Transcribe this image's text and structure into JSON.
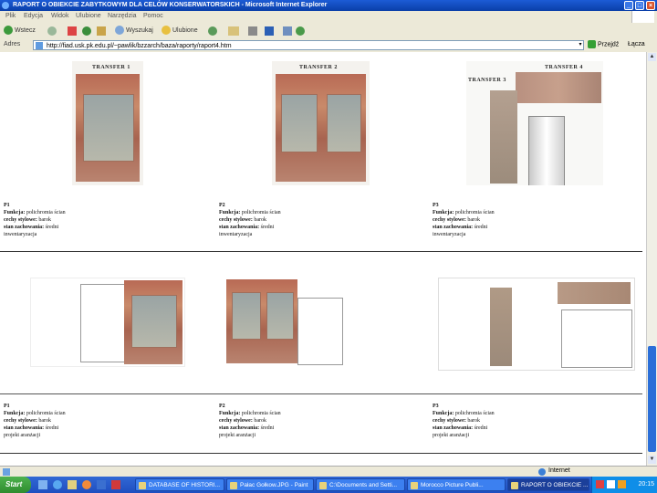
{
  "window": {
    "title": "RAPORT O OBIEKCIE ZABYTKOWYM DLA CELÓW KONSERWATORSKICH - Microsoft Internet Explorer"
  },
  "menubar": [
    "Plik",
    "Edycja",
    "Widok",
    "Ulubione",
    "Narzędzia",
    "Pomoc"
  ],
  "toolbar": {
    "back": "Wstecz",
    "search": "Wyszukaj",
    "favorites": "Ulubione"
  },
  "address": {
    "label": "Adres",
    "url": "http://fiad.usk.pk.edu.pl/~pawlik/bzzarch/baza/raporty/raport4.htm",
    "go": "Przejdź",
    "links": "Łącza"
  },
  "rows": [
    {
      "items": [
        {
          "title": "TRANSFER 1",
          "code": "P1",
          "function_label": "Funkcja:",
          "function": "polichromia ścian",
          "style_label": "cechy stylowe:",
          "style": "barok",
          "state_label": "stan zachowania:",
          "state": "średni",
          "note": "inwentaryzacja"
        },
        {
          "title": "TRANSFER 2",
          "code": "P2",
          "function_label": "Funkcja:",
          "function": "polichromia ścian",
          "style_label": "cechy stylowe:",
          "style": "barok",
          "state_label": "stan zachowania:",
          "state": "średni",
          "note": "inwentaryzacja"
        },
        {
          "title": "TRANSFER 4",
          "title2": "TRANSFER 3",
          "code": "P3",
          "function_label": "Funkcja:",
          "function": "polichromia ścian",
          "style_label": "cechy stylowe:",
          "style": "barok",
          "state_label": "stan zachowania:",
          "state": "średni",
          "note": "inwentaryzacja"
        }
      ]
    },
    {
      "items": [
        {
          "code": "P1",
          "function_label": "Funkcja:",
          "function": "polichromia ścian",
          "style_label": "cechy stylowe:",
          "style": "barok",
          "state_label": "stan zachowania:",
          "state": "średni",
          "note": "projekt aranżacji"
        },
        {
          "code": "P2",
          "function_label": "Funkcja:",
          "function": "polichromia ścian",
          "style_label": "cechy stylowe:",
          "style": "barok",
          "state_label": "stan zachowania:",
          "state": "średni",
          "note": "projekt aranżacji"
        },
        {
          "code": "P3",
          "function_label": "Funkcja:",
          "function": "polichromia ścian",
          "style_label": "cechy stylowe:",
          "style": "barok",
          "state_label": "stan zachowania:",
          "state": "średni",
          "note": "projekt aranżacji"
        }
      ]
    }
  ],
  "statusbar": {
    "zone": "Internet"
  },
  "taskbar": {
    "start": "Start",
    "tasks": [
      "DATABASE OF HISTORI...",
      "Pałac Gołkow.JPG - Paint",
      "C:\\Documents and Setti...",
      "Morocco Picture Publi...",
      "RAPORT O OBIEKCIE ..."
    ],
    "clock": "20:15"
  }
}
